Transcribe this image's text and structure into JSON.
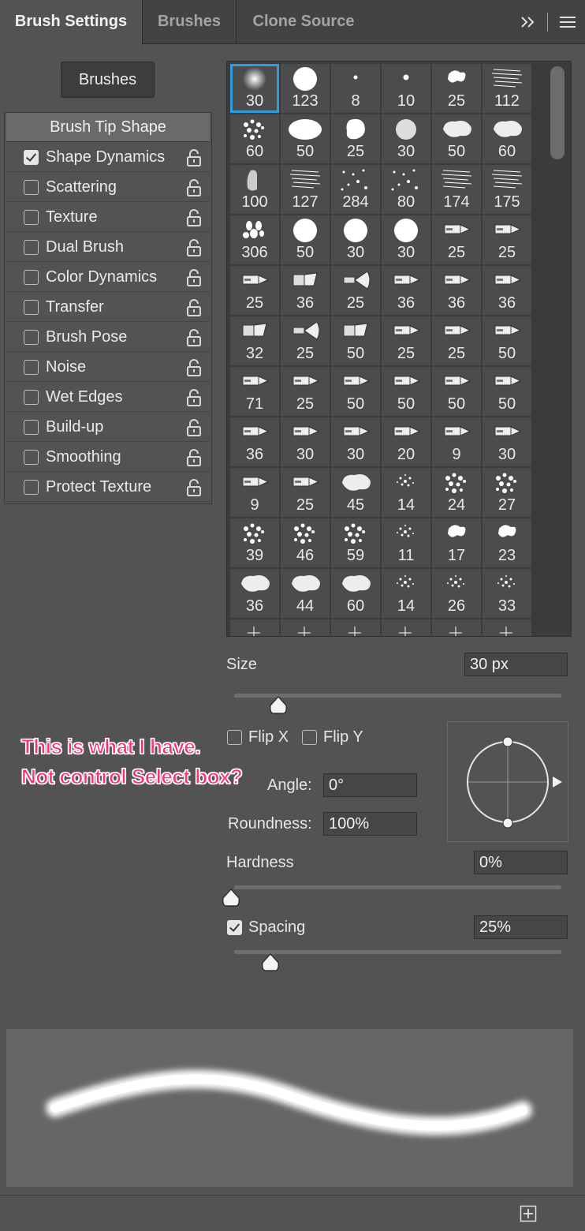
{
  "tabs": [
    {
      "label": "Brush Settings",
      "active": true
    },
    {
      "label": "Brushes",
      "active": false
    },
    {
      "label": "Clone Source",
      "active": false
    }
  ],
  "tab_menu": {
    "expand_icon": "double-chevron-right-icon",
    "menu_icon": "hamburger-menu-icon"
  },
  "brushes_button": "Brushes",
  "options": {
    "header": "Brush Tip Shape",
    "items": [
      {
        "label": "Shape Dynamics",
        "checked": true
      },
      {
        "label": "Scattering",
        "checked": false
      },
      {
        "label": "Texture",
        "checked": false
      },
      {
        "label": "Dual Brush",
        "checked": false
      },
      {
        "label": "Color Dynamics",
        "checked": false
      },
      {
        "label": "Transfer",
        "checked": false
      },
      {
        "label": "Brush Pose",
        "checked": false
      },
      {
        "label": "Noise",
        "checked": false
      },
      {
        "label": "Wet Edges",
        "checked": false
      },
      {
        "label": "Build-up",
        "checked": false
      },
      {
        "label": "Smoothing",
        "checked": false
      },
      {
        "label": "Protect Texture",
        "checked": false
      }
    ]
  },
  "brush_grid": {
    "selected_index": 0,
    "rows": [
      [
        "30",
        "123",
        "8",
        "10",
        "25",
        "112"
      ],
      [
        "60",
        "50",
        "25",
        "30",
        "50",
        "60"
      ],
      [
        "100",
        "127",
        "284",
        "80",
        "174",
        "175"
      ],
      [
        "306",
        "50",
        "30",
        "30",
        "25",
        "25"
      ],
      [
        "25",
        "36",
        "25",
        "36",
        "36",
        "36"
      ],
      [
        "32",
        "25",
        "50",
        "25",
        "25",
        "50"
      ],
      [
        "71",
        "25",
        "50",
        "50",
        "50",
        "50"
      ],
      [
        "36",
        "30",
        "30",
        "20",
        "9",
        "30"
      ],
      [
        "9",
        "25",
        "45",
        "14",
        "24",
        "27"
      ],
      [
        "39",
        "46",
        "59",
        "11",
        "17",
        "23"
      ],
      [
        "36",
        "44",
        "60",
        "14",
        "26",
        "33"
      ],
      [
        "",
        "",
        "",
        "",
        "",
        ""
      ]
    ]
  },
  "size": {
    "label": "Size",
    "value": "30 px",
    "slider_fraction": 0.1
  },
  "flip_x": {
    "label": "Flip X",
    "checked": false
  },
  "flip_y": {
    "label": "Flip Y",
    "checked": false
  },
  "angle": {
    "label": "Angle:",
    "value": "0°"
  },
  "roundness": {
    "label": "Roundness:",
    "value": "100%"
  },
  "hardness": {
    "label": "Hardness",
    "value": "0%",
    "slider_fraction": 0.0
  },
  "spacing": {
    "label": "Spacing",
    "value": "25%",
    "checked": true,
    "slider_fraction": 0.08
  },
  "annotation": {
    "line1": "This is what I have.",
    "line2": "Not control Select box?"
  },
  "footer": {
    "new_icon": "new-brush-plus-icon"
  }
}
